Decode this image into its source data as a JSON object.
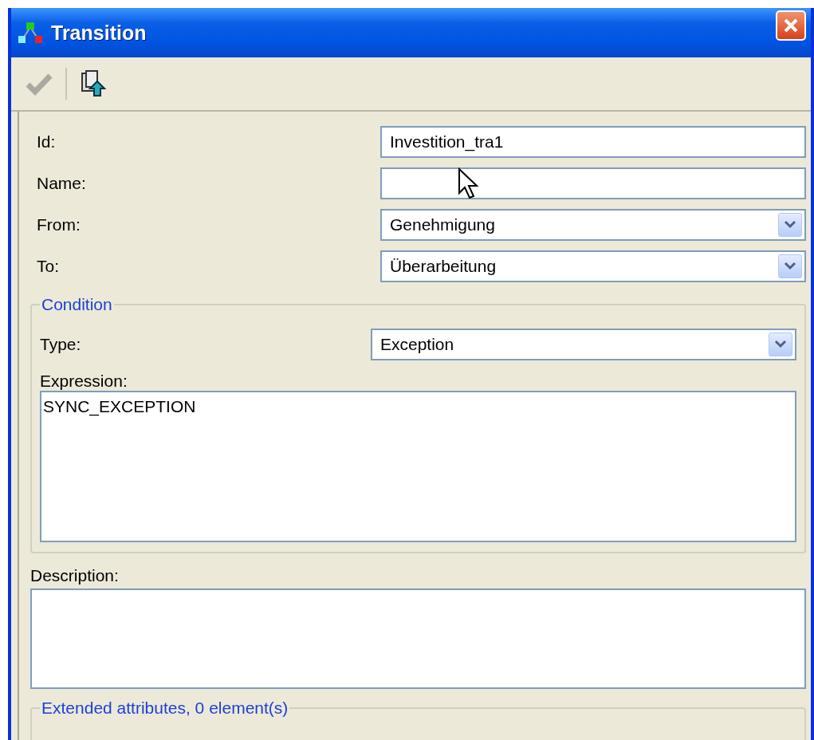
{
  "window": {
    "title": "Transition"
  },
  "toolbar": [
    {
      "kind": "check",
      "disabled": true
    },
    {
      "kind": "export",
      "disabled": false
    }
  ],
  "fields": [
    {
      "label": "Id:",
      "kind": "text",
      "value": "Investition_tra1"
    },
    {
      "label": "Name:",
      "kind": "text"
    },
    {
      "label": "From:",
      "kind": "dropdown",
      "value": "Genehmigung"
    },
    {
      "label": "To:",
      "kind": "dropdown",
      "value": "Überarbeitung"
    }
  ],
  "condition": {
    "title": "Condition",
    "type": {
      "label": "Type:",
      "value": "Exception"
    },
    "expression": {
      "label": "Expression:",
      "value": "SYNC_EXCEPTION"
    }
  },
  "description": {
    "label": "Description:"
  },
  "extended_attributes": {
    "title": "Extended attributes, 0 element(s)"
  }
}
